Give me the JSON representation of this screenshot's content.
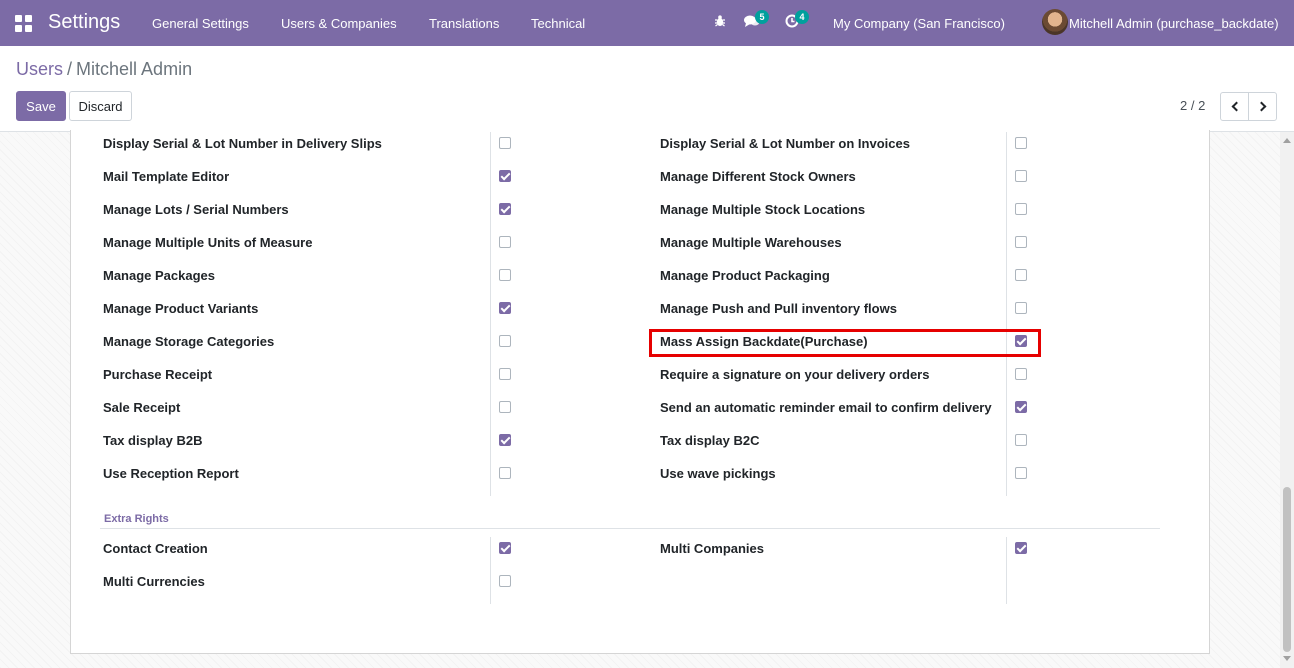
{
  "navbar": {
    "app_title": "Settings",
    "menu": [
      "General Settings",
      "Users & Companies",
      "Translations",
      "Technical"
    ],
    "icons": [
      "apps-grid-icon",
      "bug-icon",
      "chat-icon",
      "activity-clock-icon"
    ],
    "chat_badge": "5",
    "activity_badge": "4",
    "company": "My Company (San Francisco)",
    "user": "Mitchell Admin (purchase_backdate)"
  },
  "control_panel": {
    "breadcrumb_parent": "Users",
    "breadcrumb_separator": "/",
    "breadcrumb_current": "Mitchell Admin",
    "save_label": "Save",
    "discard_label": "Discard",
    "pager": "2 / 2"
  },
  "rights": {
    "left": [
      {
        "label": "Display Serial & Lot Number in Delivery Slips",
        "checked": false
      },
      {
        "label": "Mail Template Editor",
        "checked": true
      },
      {
        "label": "Manage Lots / Serial Numbers",
        "checked": true
      },
      {
        "label": "Manage Multiple Units of Measure",
        "checked": false
      },
      {
        "label": "Manage Packages",
        "checked": false
      },
      {
        "label": "Manage Product Variants",
        "checked": true
      },
      {
        "label": "Manage Storage Categories",
        "checked": false
      },
      {
        "label": "Purchase Receipt",
        "checked": false
      },
      {
        "label": "Sale Receipt",
        "checked": false
      },
      {
        "label": "Tax display B2B",
        "checked": true
      },
      {
        "label": "Use Reception Report",
        "checked": false
      }
    ],
    "right": [
      {
        "label": "Display Serial & Lot Number on Invoices",
        "checked": false
      },
      {
        "label": "Manage Different Stock Owners",
        "checked": false
      },
      {
        "label": "Manage Multiple Stock Locations",
        "checked": false
      },
      {
        "label": "Manage Multiple Warehouses",
        "checked": false
      },
      {
        "label": "Manage Product Packaging",
        "checked": false
      },
      {
        "label": "Manage Push and Pull inventory flows",
        "checked": false
      },
      {
        "label": "Mass Assign Backdate(Purchase)",
        "checked": true
      },
      {
        "label": "Require a signature on your delivery orders",
        "checked": false
      },
      {
        "label": "Send an automatic reminder email to confirm delivery",
        "checked": true
      },
      {
        "label": "Tax display B2C",
        "checked": false
      },
      {
        "label": "Use wave pickings",
        "checked": false
      }
    ]
  },
  "extra_rights": {
    "title": "Extra Rights",
    "left": [
      {
        "label": "Contact Creation",
        "checked": true
      },
      {
        "label": "Multi Currencies",
        "checked": false
      }
    ],
    "right": [
      {
        "label": "Multi Companies",
        "checked": true
      }
    ]
  },
  "colors": {
    "brand": "#7C6BA6",
    "highlight": "#e60000"
  }
}
